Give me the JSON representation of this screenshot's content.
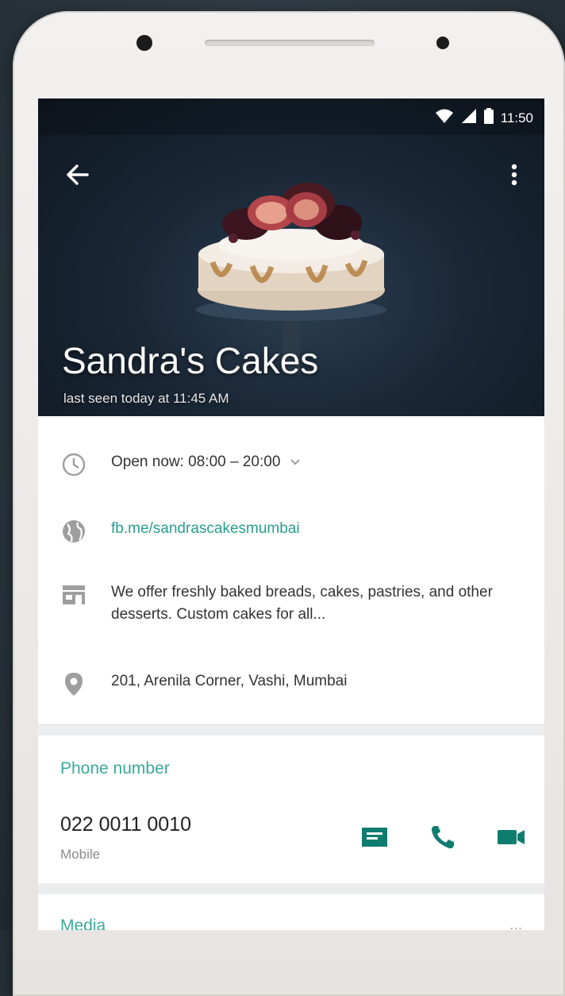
{
  "status_bar": {
    "time": "11:50"
  },
  "header": {
    "title": "Sandra's Cakes",
    "last_seen": "last seen today at 11:45 AM"
  },
  "business_info": {
    "hours": "Open now: 08:00 – 20:00",
    "website": "fb.me/sandrascakesmumbai",
    "description": "We offer freshly baked breads, cakes, pastries, and other desserts. Custom cakes for all...",
    "address": "201, Arenila Corner, Vashi, Mumbai"
  },
  "phone_section": {
    "label": "Phone number",
    "number": "022 0011 0010",
    "type": "Mobile"
  },
  "media_section": {
    "label": "Media",
    "count": "..."
  },
  "colors": {
    "accent": "#3ba99a",
    "action_icon": "#0f7c70",
    "header_bg": "#1a2736"
  },
  "icons": {
    "back": "arrow-left",
    "menu": "vertical-dots",
    "hours": "clock",
    "website": "globe",
    "description": "storefront",
    "address": "location-pin",
    "message": "message",
    "call": "phone",
    "video": "videocam"
  }
}
